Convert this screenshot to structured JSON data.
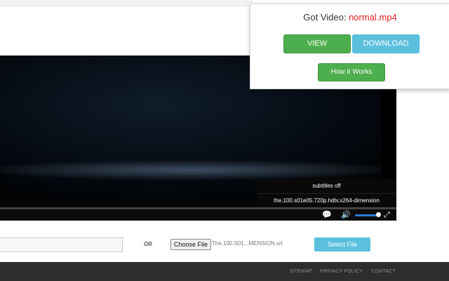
{
  "popup": {
    "title_prefix": "Got Video: ",
    "file_name": "normal.mp4",
    "view_label": "VIEW",
    "download_label": "DOWNLOAD",
    "how_label": "How it Works"
  },
  "player": {
    "subtitle_options": [
      "subtitles off",
      "the.100.s01e05.720p.hdtv.x264-dimension"
    ],
    "icons": {
      "captions": "captions-icon",
      "volume": "volume-icon",
      "fullscreen": "fullscreen-icon"
    }
  },
  "file_row": {
    "or_label": "OR",
    "choose_label": "Choose File",
    "selected_file": "The.100.S01...MENSION.srt",
    "select_label": "Select File"
  },
  "footer": {
    "links": [
      "SITEMAP",
      "PRIVACY POLICY",
      "CONTACT"
    ]
  },
  "colors": {
    "green": "#4cae4c",
    "blue": "#5bc0de",
    "filename_red": "#e02020",
    "footer_bg": "#2d2d2d"
  }
}
